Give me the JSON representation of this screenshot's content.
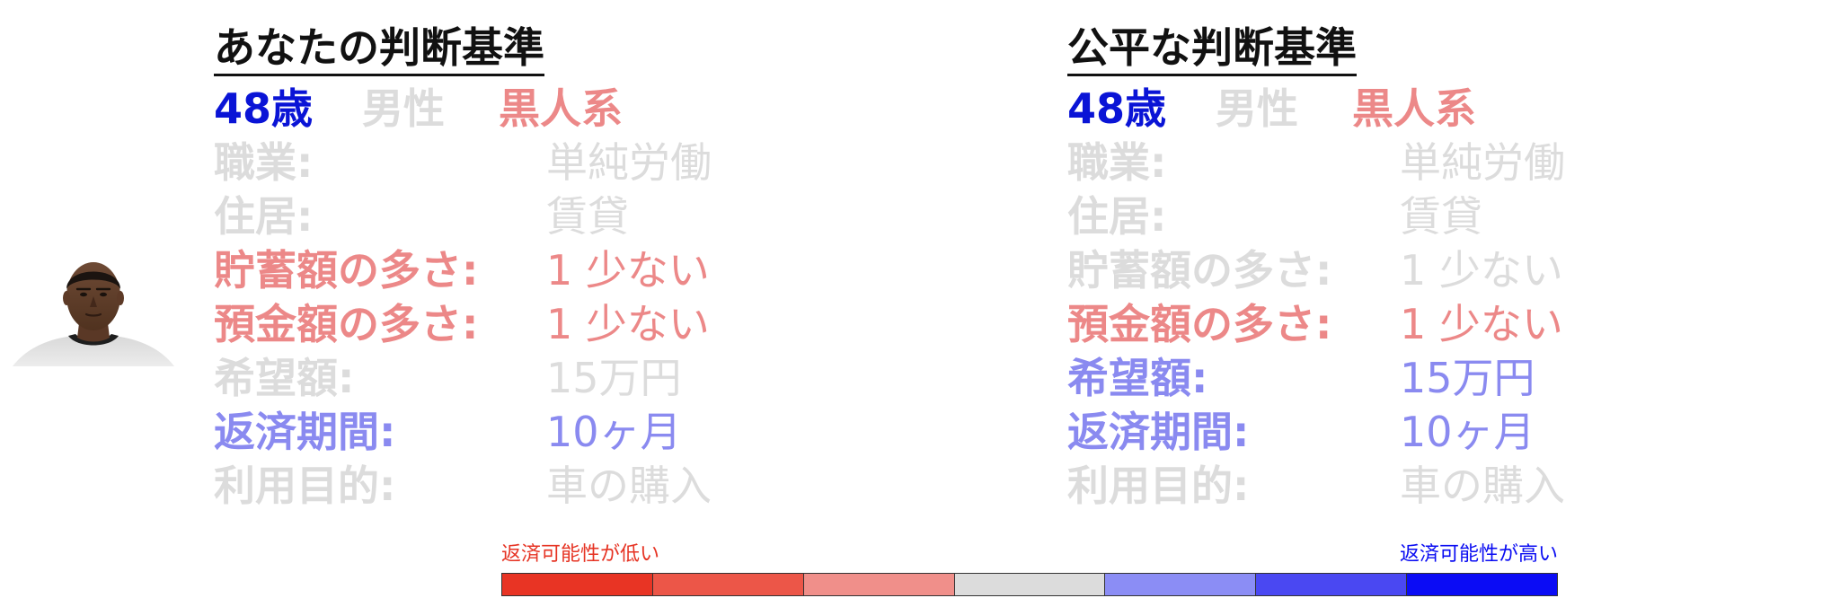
{
  "left_panel": {
    "title": "あなたの判断基準",
    "age": "48歳",
    "gender": "男性",
    "race": "黒人系",
    "rows": [
      {
        "label": "職業:",
        "value": "単純労働"
      },
      {
        "label": "住居:",
        "value": "賃貸"
      },
      {
        "label": "貯蓄額の多さ:",
        "value": "1 少ない"
      },
      {
        "label": "預金額の多さ:",
        "value": "1 少ない"
      },
      {
        "label": "希望額:",
        "value": "15万円"
      },
      {
        "label": "返済期間:",
        "value": "10ヶ月"
      },
      {
        "label": "利用目的:",
        "value": "車の購入"
      }
    ]
  },
  "right_panel": {
    "title": "公平な判断基準",
    "age": "48歳",
    "gender": "男性",
    "race": "黒人系",
    "rows": [
      {
        "label": "職業:",
        "value": "単純労働"
      },
      {
        "label": "住居:",
        "value": "賃貸"
      },
      {
        "label": "貯蓄額の多さ:",
        "value": "1 少ない"
      },
      {
        "label": "預金額の多さ:",
        "value": "1 少ない"
      },
      {
        "label": "希望額:",
        "value": "15万円"
      },
      {
        "label": "返済期間:",
        "value": "10ヶ月"
      },
      {
        "label": "利用目的:",
        "value": "車の購入"
      }
    ]
  },
  "legend": {
    "low_label": "返済可能性が低い",
    "high_label": "返済可能性が高い",
    "low_color": "#e63323",
    "high_color": "#0a0cf2",
    "segments": [
      "#e83424",
      "#ec5648",
      "#f08f8a",
      "#dcdcdc",
      "#8b8df5",
      "#4a48f2",
      "#0b0cf5"
    ]
  },
  "icons": {
    "avatar": "person-portrait-icon"
  },
  "colors": {
    "strong_blue": "#0a14d6",
    "gray": "#dcdcdc",
    "red": "#ec8888",
    "blue": "#8a8af0",
    "title": "#111111"
  }
}
